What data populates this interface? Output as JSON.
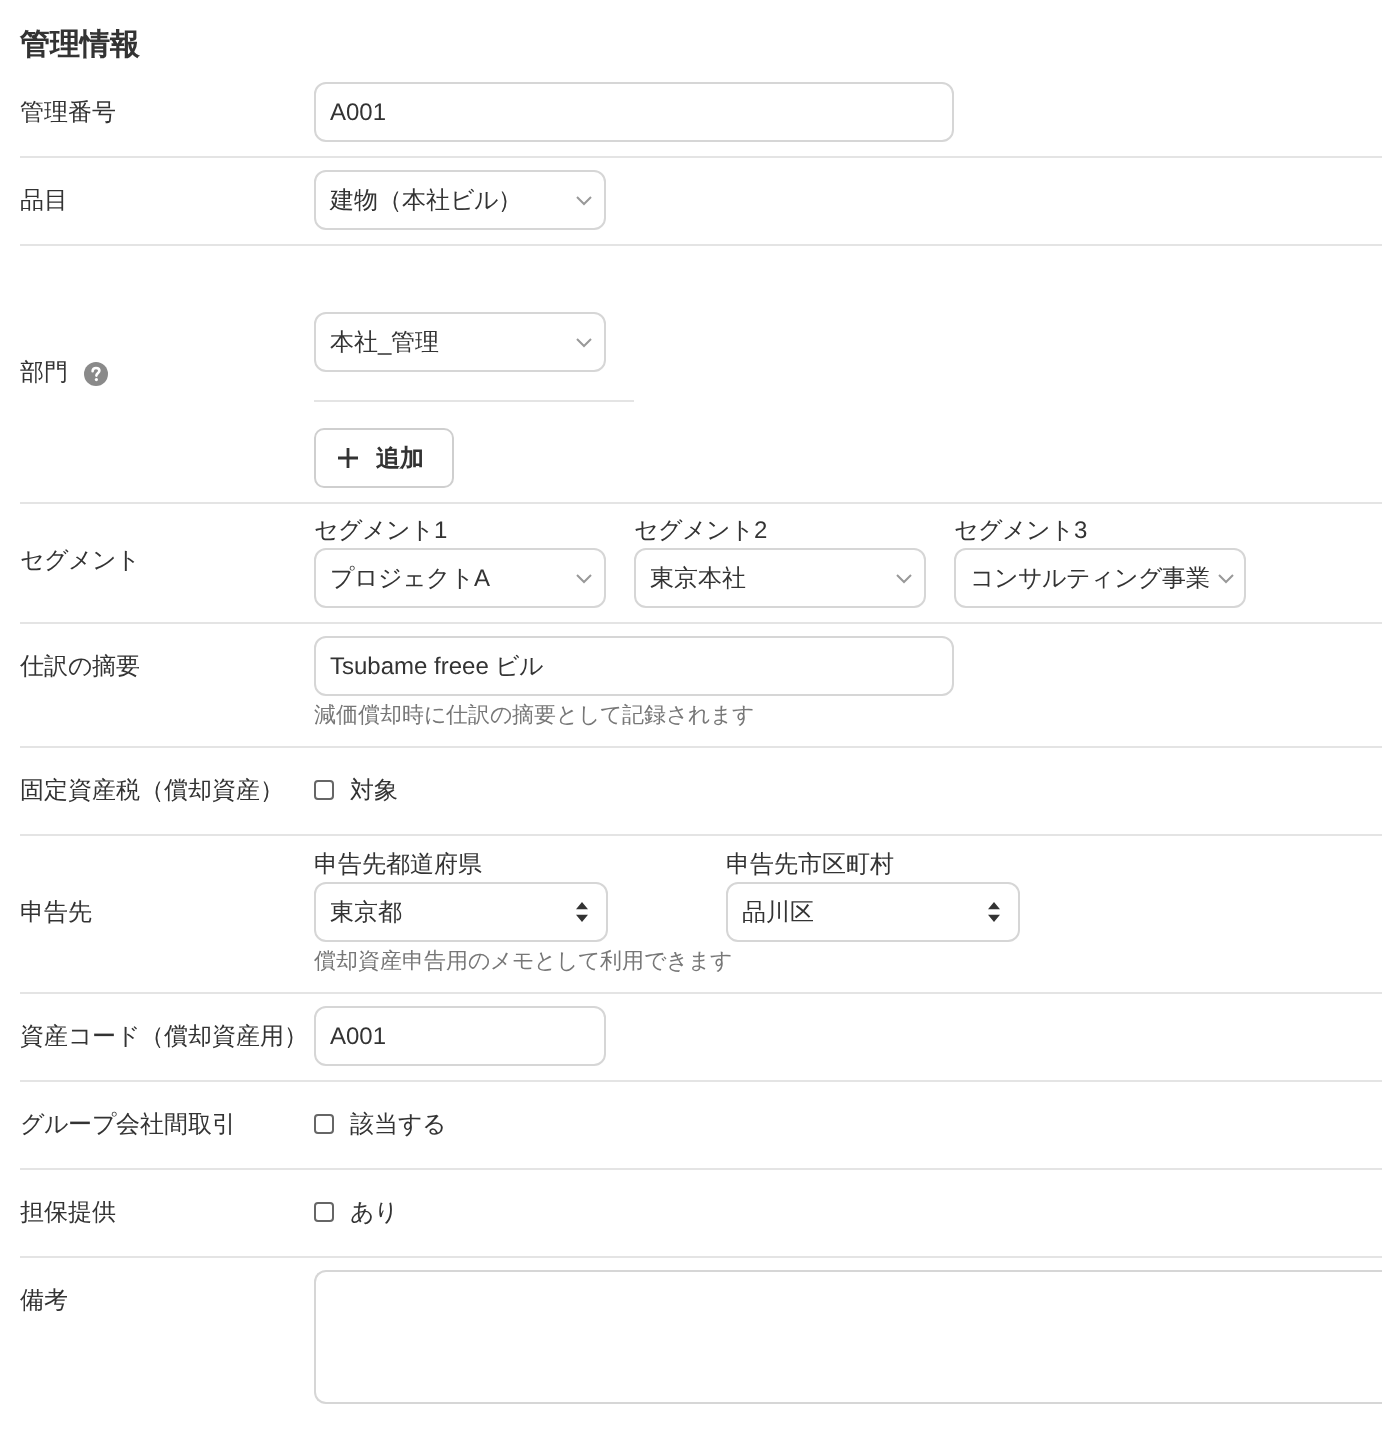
{
  "section": {
    "title": "管理情報"
  },
  "rows": [
    {
      "kind": "text",
      "label": "管理番号",
      "value": "A001"
    },
    {
      "kind": "select",
      "label": "品目",
      "value": "建物（本社ビル）"
    },
    {
      "kind": "department",
      "label": "部門",
      "help": true,
      "value": "本社_管理",
      "button": "追加"
    },
    {
      "kind": "segments",
      "label": "セグメント",
      "fields": [
        {
          "label": "セグメント1",
          "value": "プロジェクトA"
        },
        {
          "label": "セグメント2",
          "value": "東京本社"
        },
        {
          "label": "セグメント3",
          "value": "コンサルティング事業"
        }
      ]
    },
    {
      "kind": "text",
      "label": "仕訳の摘要",
      "value": "Tsubame freee ビル",
      "hint": "減価償却時に仕訳の摘要として記録されます"
    },
    {
      "kind": "checkbox",
      "label": "固定資産税（償却資産）",
      "option": "対象",
      "checked": false
    },
    {
      "kind": "location",
      "label": "申告先",
      "fields": [
        {
          "label": "申告先都道府県",
          "value": "東京都"
        },
        {
          "label": "申告先市区町村",
          "value": "品川区"
        }
      ],
      "hint": "償却資産申告用のメモとして利用できます"
    },
    {
      "kind": "shorttext",
      "label": "資産コード（償却資産用）",
      "value": "A001"
    },
    {
      "kind": "checkbox",
      "label": "グループ会社間取引",
      "option": "該当する",
      "checked": false
    },
    {
      "kind": "checkbox",
      "label": "担保提供",
      "option": "あり",
      "checked": false
    },
    {
      "kind": "memo",
      "label": "備考"
    }
  ]
}
